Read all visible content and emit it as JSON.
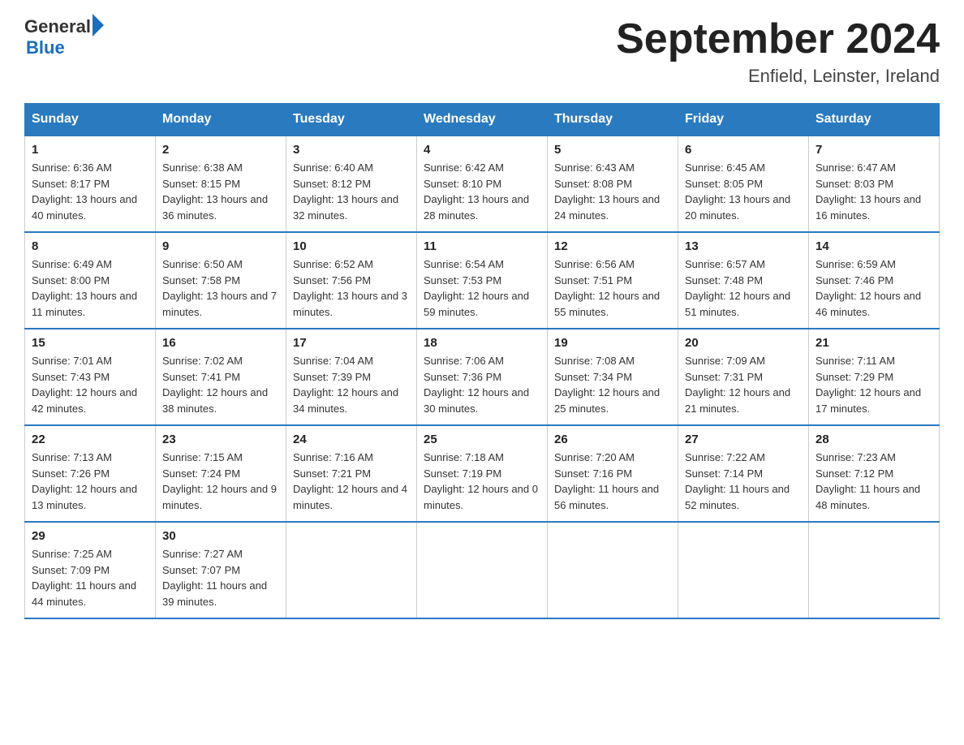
{
  "header": {
    "logo_general": "General",
    "logo_blue": "Blue",
    "month_title": "September 2024",
    "location": "Enfield, Leinster, Ireland"
  },
  "days_of_week": [
    "Sunday",
    "Monday",
    "Tuesday",
    "Wednesday",
    "Thursday",
    "Friday",
    "Saturday"
  ],
  "weeks": [
    [
      {
        "day": "1",
        "sunrise": "6:36 AM",
        "sunset": "8:17 PM",
        "daylight": "13 hours and 40 minutes."
      },
      {
        "day": "2",
        "sunrise": "6:38 AM",
        "sunset": "8:15 PM",
        "daylight": "13 hours and 36 minutes."
      },
      {
        "day": "3",
        "sunrise": "6:40 AM",
        "sunset": "8:12 PM",
        "daylight": "13 hours and 32 minutes."
      },
      {
        "day": "4",
        "sunrise": "6:42 AM",
        "sunset": "8:10 PM",
        "daylight": "13 hours and 28 minutes."
      },
      {
        "day": "5",
        "sunrise": "6:43 AM",
        "sunset": "8:08 PM",
        "daylight": "13 hours and 24 minutes."
      },
      {
        "day": "6",
        "sunrise": "6:45 AM",
        "sunset": "8:05 PM",
        "daylight": "13 hours and 20 minutes."
      },
      {
        "day": "7",
        "sunrise": "6:47 AM",
        "sunset": "8:03 PM",
        "daylight": "13 hours and 16 minutes."
      }
    ],
    [
      {
        "day": "8",
        "sunrise": "6:49 AM",
        "sunset": "8:00 PM",
        "daylight": "13 hours and 11 minutes."
      },
      {
        "day": "9",
        "sunrise": "6:50 AM",
        "sunset": "7:58 PM",
        "daylight": "13 hours and 7 minutes."
      },
      {
        "day": "10",
        "sunrise": "6:52 AM",
        "sunset": "7:56 PM",
        "daylight": "13 hours and 3 minutes."
      },
      {
        "day": "11",
        "sunrise": "6:54 AM",
        "sunset": "7:53 PM",
        "daylight": "12 hours and 59 minutes."
      },
      {
        "day": "12",
        "sunrise": "6:56 AM",
        "sunset": "7:51 PM",
        "daylight": "12 hours and 55 minutes."
      },
      {
        "day": "13",
        "sunrise": "6:57 AM",
        "sunset": "7:48 PM",
        "daylight": "12 hours and 51 minutes."
      },
      {
        "day": "14",
        "sunrise": "6:59 AM",
        "sunset": "7:46 PM",
        "daylight": "12 hours and 46 minutes."
      }
    ],
    [
      {
        "day": "15",
        "sunrise": "7:01 AM",
        "sunset": "7:43 PM",
        "daylight": "12 hours and 42 minutes."
      },
      {
        "day": "16",
        "sunrise": "7:02 AM",
        "sunset": "7:41 PM",
        "daylight": "12 hours and 38 minutes."
      },
      {
        "day": "17",
        "sunrise": "7:04 AM",
        "sunset": "7:39 PM",
        "daylight": "12 hours and 34 minutes."
      },
      {
        "day": "18",
        "sunrise": "7:06 AM",
        "sunset": "7:36 PM",
        "daylight": "12 hours and 30 minutes."
      },
      {
        "day": "19",
        "sunrise": "7:08 AM",
        "sunset": "7:34 PM",
        "daylight": "12 hours and 25 minutes."
      },
      {
        "day": "20",
        "sunrise": "7:09 AM",
        "sunset": "7:31 PM",
        "daylight": "12 hours and 21 minutes."
      },
      {
        "day": "21",
        "sunrise": "7:11 AM",
        "sunset": "7:29 PM",
        "daylight": "12 hours and 17 minutes."
      }
    ],
    [
      {
        "day": "22",
        "sunrise": "7:13 AM",
        "sunset": "7:26 PM",
        "daylight": "12 hours and 13 minutes."
      },
      {
        "day": "23",
        "sunrise": "7:15 AM",
        "sunset": "7:24 PM",
        "daylight": "12 hours and 9 minutes."
      },
      {
        "day": "24",
        "sunrise": "7:16 AM",
        "sunset": "7:21 PM",
        "daylight": "12 hours and 4 minutes."
      },
      {
        "day": "25",
        "sunrise": "7:18 AM",
        "sunset": "7:19 PM",
        "daylight": "12 hours and 0 minutes."
      },
      {
        "day": "26",
        "sunrise": "7:20 AM",
        "sunset": "7:16 PM",
        "daylight": "11 hours and 56 minutes."
      },
      {
        "day": "27",
        "sunrise": "7:22 AM",
        "sunset": "7:14 PM",
        "daylight": "11 hours and 52 minutes."
      },
      {
        "day": "28",
        "sunrise": "7:23 AM",
        "sunset": "7:12 PM",
        "daylight": "11 hours and 48 minutes."
      }
    ],
    [
      {
        "day": "29",
        "sunrise": "7:25 AM",
        "sunset": "7:09 PM",
        "daylight": "11 hours and 44 minutes."
      },
      {
        "day": "30",
        "sunrise": "7:27 AM",
        "sunset": "7:07 PM",
        "daylight": "11 hours and 39 minutes."
      },
      null,
      null,
      null,
      null,
      null
    ]
  ]
}
